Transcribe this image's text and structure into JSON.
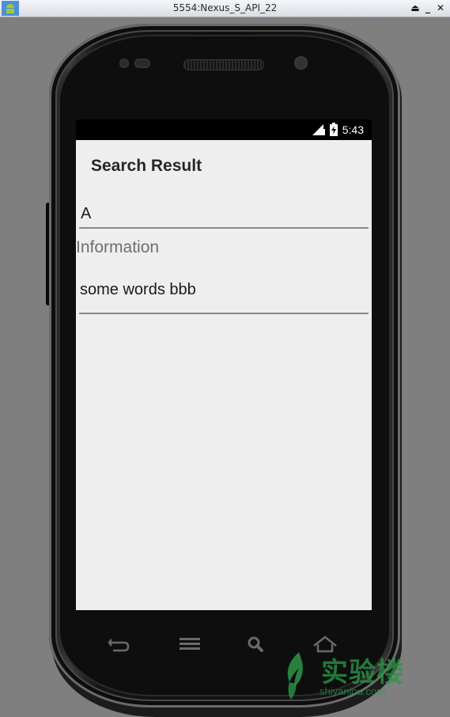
{
  "window": {
    "title": "5554:Nexus_S_API_22",
    "buttons": [
      "⏏",
      "_",
      "✕"
    ]
  },
  "status_bar": {
    "time": "5:43",
    "icons": [
      "signal-icon",
      "battery-charging-icon"
    ]
  },
  "app": {
    "title": "Search Result",
    "field1_value": "A",
    "info_label": "Information",
    "field2_value": "some words bbb"
  },
  "nav_keys": [
    "back-icon",
    "menu-icon",
    "search-icon",
    "home-icon"
  ],
  "watermark": {
    "brand": "实验楼",
    "site": "shiyanlou.com",
    "color": "#2e9447"
  }
}
